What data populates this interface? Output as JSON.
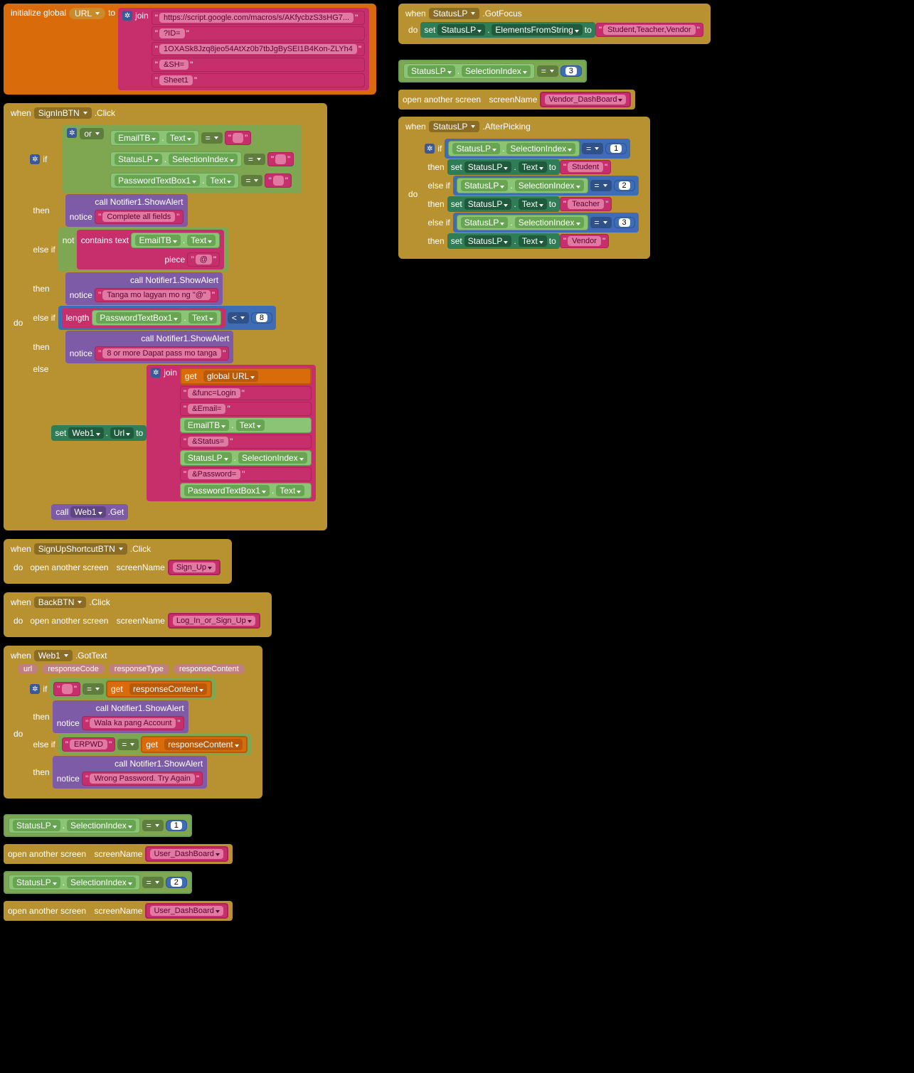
{
  "init": {
    "label_init": "initialize global",
    "var": "URL",
    "to": "to",
    "join": "join",
    "lines": [
      "https://script.google.com/macros/s/AKfycbzS3sHG7...",
      "?ID=",
      "1OXASk8Jzq8jeo54AtXz0b7tbJgBySEI1B4Kon-ZLYh4",
      "&SH=",
      "Sheet1"
    ]
  },
  "signin": {
    "when": "when",
    "comp": "SignInBTN",
    "event": ".Click",
    "do": "do",
    "if": "if",
    "or": "or",
    "emailtb": "EmailTB",
    "text": "Text",
    "eq": "=",
    "statuslp": "StatusLP",
    "selindex": "SelectionIndex",
    "pwd": "PasswordTextBox1",
    "then": "then",
    "call": "call",
    "notifier": "Notifier1",
    "showalert": ".ShowAlert",
    "notice": "notice",
    "msg1": "Complete all fields",
    "elseif": "else if",
    "not": "not",
    "contains": "contains",
    "piece": "piece",
    "at": "@",
    "msg2": "Tanga mo lagyan mo ng \"@\"",
    "length": "length",
    "lt": "<",
    "eight": "8",
    "msg3": "8 or more Dapat pass mo tanga",
    "else": "else",
    "set": "set",
    "web1": "Web1",
    "url": "Url",
    "get": "get",
    "globalurl": "global URL",
    "join": "join",
    "jlines": [
      "&func=Login",
      "&Email=",
      "&Status=",
      "&Password="
    ],
    "getcall": ".Get"
  },
  "signup": {
    "comp": "SignUpShortcutBTN",
    "event": ".Click",
    "open": "open another screen",
    "sn": "screenName",
    "screen": "Sign_Up"
  },
  "back": {
    "comp": "BackBTN",
    "event": ".Click",
    "screen": "Log_In_or_Sign_Up"
  },
  "gottext": {
    "comp": "Web1",
    "event": ".GotText",
    "p1": "url",
    "p2": "responseCode",
    "p3": "responseType",
    "p4": "responseContent",
    "msg1": "Wala ka pang Account",
    "erpwd": "ERPWD",
    "msg2": "Wrong Password. Try Again"
  },
  "floaters": {
    "one": "1",
    "two": "2",
    "ud": "User_DashBoard"
  },
  "gotfocus": {
    "event": ".GotFocus",
    "efs": "ElementsFromString",
    "list": "Student,Teacher,Vendor"
  },
  "float3": {
    "three": "3"
  },
  "vendor": {
    "screen": "Vendor_DashBoard"
  },
  "afterpick": {
    "event": ".AfterPicking",
    "student": "Student",
    "teacher": "Teacher",
    "vendor": "Vendor"
  },
  "kw": {
    "when": "when",
    "do": "do",
    "if": "if",
    "then": "then",
    "elseif": "else if",
    "else": "else",
    "call": "call",
    "set": "set",
    "to": "to",
    "get": "get",
    "open": "open another screen",
    "sn": "screenName",
    "text": "text",
    "notice": "notice"
  }
}
